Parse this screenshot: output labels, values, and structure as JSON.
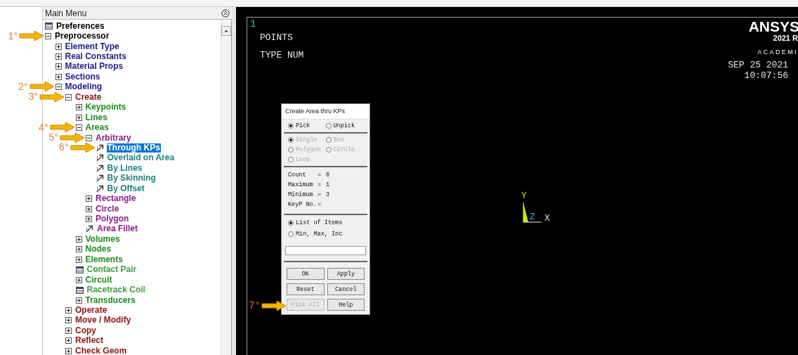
{
  "main_menu": {
    "title": "Main Menu",
    "tree": [
      {
        "label": "Preferences",
        "kind": "dialog",
        "selected": false
      },
      {
        "label": "Preprocessor",
        "kind": "folder",
        "expanded": true,
        "selected": false,
        "callout": "1°",
        "children": [
          {
            "label": "Element Type",
            "kind": "folder",
            "expanded": false,
            "selected": false
          },
          {
            "label": "Real Constants",
            "kind": "folder",
            "expanded": false,
            "selected": false
          },
          {
            "label": "Material Props",
            "kind": "folder",
            "expanded": false,
            "selected": false
          },
          {
            "label": "Sections",
            "kind": "folder",
            "expanded": false,
            "selected": false
          },
          {
            "label": "Modeling",
            "kind": "folder",
            "expanded": true,
            "selected": false,
            "callout": "2°",
            "children": [
              {
                "label": "Create",
                "kind": "folder",
                "expanded": true,
                "selected": false,
                "callout": "3°",
                "children": [
                  {
                    "label": "Keypoints",
                    "kind": "folder",
                    "expanded": false,
                    "selected": false
                  },
                  {
                    "label": "Lines",
                    "kind": "folder",
                    "expanded": false,
                    "selected": false
                  },
                  {
                    "label": "Areas",
                    "kind": "folder",
                    "expanded": true,
                    "selected": false,
                    "callout": "4°",
                    "children": [
                      {
                        "label": "Arbitrary",
                        "kind": "folder",
                        "expanded": true,
                        "selected": false,
                        "callout": "5°",
                        "children": [
                          {
                            "label": "Through KPs",
                            "kind": "action",
                            "selected": true,
                            "callout": "6°"
                          },
                          {
                            "label": "Overlaid on Area",
                            "kind": "action",
                            "selected": false
                          },
                          {
                            "label": "By Lines",
                            "kind": "action",
                            "selected": false
                          },
                          {
                            "label": "By Skinning",
                            "kind": "action",
                            "selected": false
                          },
                          {
                            "label": "By Offset",
                            "kind": "action",
                            "selected": false
                          }
                        ]
                      },
                      {
                        "label": "Rectangle",
                        "kind": "folder",
                        "expanded": false,
                        "selected": false
                      },
                      {
                        "label": "Circle",
                        "kind": "folder",
                        "expanded": false,
                        "selected": false
                      },
                      {
                        "label": "Polygon",
                        "kind": "folder",
                        "expanded": false,
                        "selected": false
                      },
                      {
                        "label": "Area Fillet",
                        "kind": "action",
                        "selected": false
                      }
                    ]
                  },
                  {
                    "label": "Volumes",
                    "kind": "folder",
                    "expanded": false,
                    "selected": false
                  },
                  {
                    "label": "Nodes",
                    "kind": "folder",
                    "expanded": false,
                    "selected": false
                  },
                  {
                    "label": "Elements",
                    "kind": "folder",
                    "expanded": false,
                    "selected": false
                  },
                  {
                    "label": "Contact Pair",
                    "kind": "dialog",
                    "selected": false
                  },
                  {
                    "label": "Circuit",
                    "kind": "folder",
                    "expanded": false,
                    "selected": false
                  },
                  {
                    "label": "Racetrack Coil",
                    "kind": "dialog",
                    "selected": false
                  },
                  {
                    "label": "Transducers",
                    "kind": "folder",
                    "expanded": false,
                    "selected": false
                  }
                ]
              },
              {
                "label": "Operate",
                "kind": "folder",
                "expanded": false,
                "selected": false
              },
              {
                "label": "Move / Modify",
                "kind": "folder",
                "expanded": false,
                "selected": false
              },
              {
                "label": "Copy",
                "kind": "folder",
                "expanded": false,
                "selected": false
              },
              {
                "label": "Reflect",
                "kind": "folder",
                "expanded": false,
                "selected": false
              },
              {
                "label": "Check Geom",
                "kind": "folder",
                "expanded": false,
                "selected": false
              }
            ]
          }
        ]
      }
    ]
  },
  "graphics": {
    "window_number": "1",
    "lines": [
      "POINTS",
      "TYPE NUM"
    ],
    "logo": {
      "name": "ANSYS",
      "version": "2021 R",
      "edition": "ACADEMI"
    },
    "date": "SEP 25 2021",
    "time": "10:07:56",
    "triad": {
      "labels": [
        "Y",
        "Z",
        "X"
      ]
    }
  },
  "dialog": {
    "title": "Create Area thru KPs",
    "pick_mode": [
      {
        "label": "Pick",
        "selected": true
      },
      {
        "label": "Unpick",
        "selected": false
      }
    ],
    "pick_type": [
      {
        "label": "Single",
        "selected": true,
        "disabled": true
      },
      {
        "label": "Box",
        "selected": false,
        "disabled": true
      },
      {
        "label": "Polygon",
        "selected": false,
        "disabled": true
      },
      {
        "label": "Circle",
        "selected": false,
        "disabled": true
      },
      {
        "label": "Loop",
        "selected": false,
        "disabled": true
      }
    ],
    "stats": [
      {
        "label": "Count",
        "sign": "=",
        "value": "0"
      },
      {
        "label": "Maximum",
        "sign": "=",
        "value": "1"
      },
      {
        "label": "Minimum",
        "sign": "=",
        "value": "3"
      },
      {
        "label": "KeyP No.",
        "sign": "="
      }
    ],
    "list_mode": [
      {
        "label": "List of Items",
        "selected": true
      },
      {
        "label": "Min, Max, Inc",
        "selected": false
      }
    ],
    "buttons": [
      {
        "label": "OK",
        "disabled": false
      },
      {
        "label": "Apply",
        "disabled": false
      },
      {
        "label": "Reset",
        "disabled": false
      },
      {
        "label": "Cancel",
        "disabled": false
      },
      {
        "label": "Pick All",
        "disabled": true,
        "callout": "7°"
      },
      {
        "label": "Help",
        "disabled": false
      }
    ]
  }
}
